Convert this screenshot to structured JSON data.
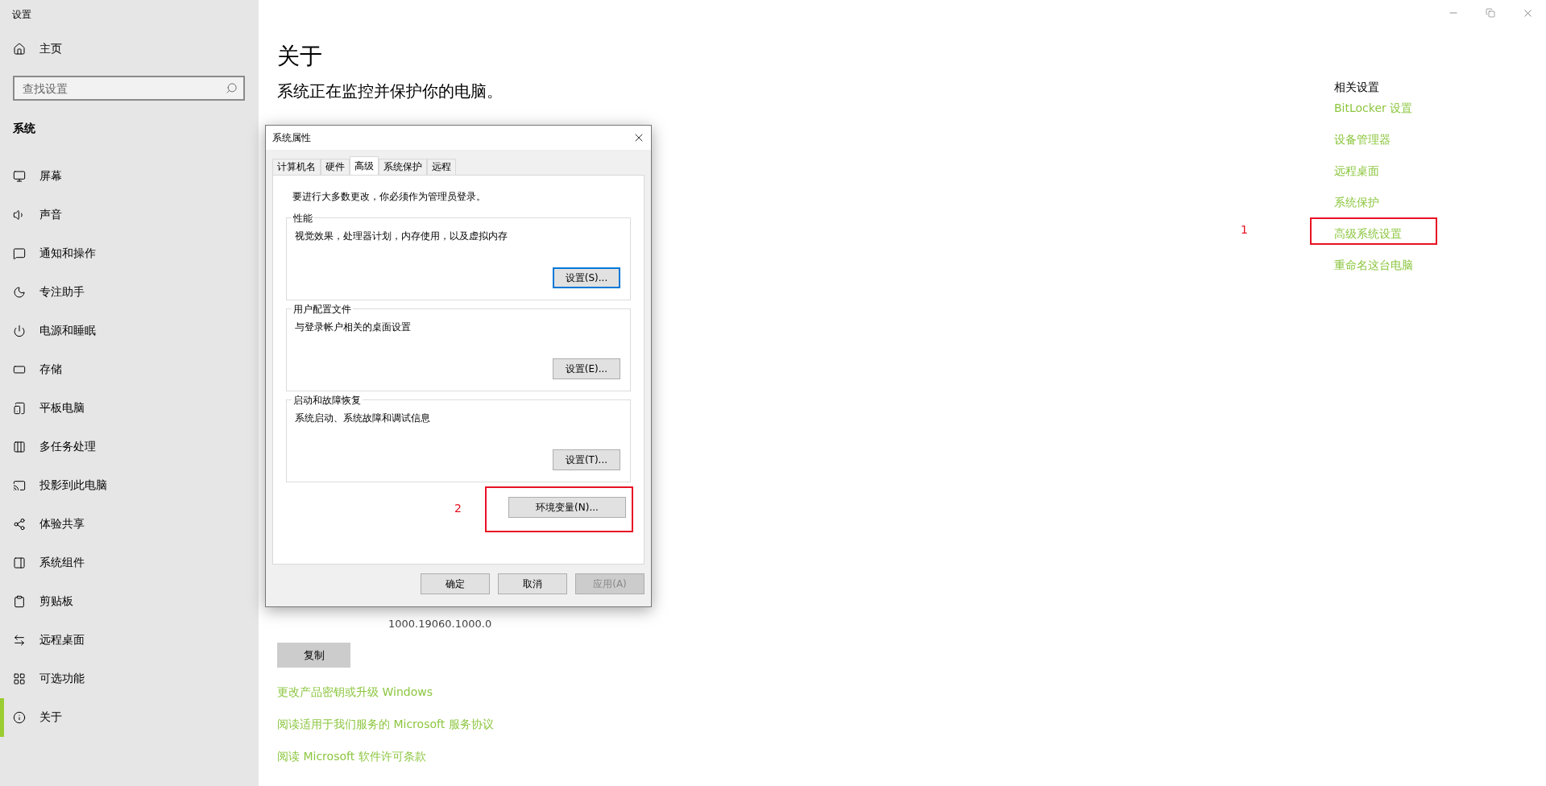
{
  "window": {
    "title": "设置"
  },
  "sidebar": {
    "home": "主页",
    "search": {
      "placeholder": "查找设置"
    },
    "section": "系统",
    "items": [
      {
        "label": "屏幕",
        "selected": false
      },
      {
        "label": "声音",
        "selected": false
      },
      {
        "label": "通知和操作",
        "selected": false
      },
      {
        "label": "专注助手",
        "selected": false
      },
      {
        "label": "电源和睡眠",
        "selected": false
      },
      {
        "label": "存储",
        "selected": false
      },
      {
        "label": "平板电脑",
        "selected": false
      },
      {
        "label": "多任务处理",
        "selected": false
      },
      {
        "label": "投影到此电脑",
        "selected": false
      },
      {
        "label": "体验共享",
        "selected": false
      },
      {
        "label": "系统组件",
        "selected": false
      },
      {
        "label": "剪贴板",
        "selected": false
      },
      {
        "label": "远程桌面",
        "selected": false
      },
      {
        "label": "可选功能",
        "selected": false
      },
      {
        "label": "关于",
        "selected": true
      }
    ]
  },
  "main": {
    "title": "关于",
    "subtitle": "系统正在监控并保护你的电脑。",
    "version": "1000.19060.1000.0",
    "copy_button": "复制",
    "links": [
      "更改产品密钥或升级 Windows",
      "阅读适用于我们服务的 Microsoft 服务协议",
      "阅读 Microsoft 软件许可条款"
    ]
  },
  "related": {
    "title": "相关设置",
    "links": [
      {
        "label": "BitLocker 设置",
        "annotated": false
      },
      {
        "label": "设备管理器",
        "annotated": false
      },
      {
        "label": "远程桌面",
        "annotated": false
      },
      {
        "label": "系统保护",
        "annotated": false
      },
      {
        "label": "高级系统设置",
        "annotated": true,
        "annotation": "1"
      },
      {
        "label": "重命名这台电脑",
        "annotated": false
      }
    ]
  },
  "dialog": {
    "title": "系统属性",
    "tabs": [
      {
        "label": "计算机名",
        "selected": false
      },
      {
        "label": "硬件",
        "selected": false
      },
      {
        "label": "高级",
        "selected": true
      },
      {
        "label": "系统保护",
        "selected": false
      },
      {
        "label": "远程",
        "selected": false
      }
    ],
    "note": "要进行大多数更改，你必须作为管理员登录。",
    "groups": [
      {
        "title": "性能",
        "text": "视觉效果，处理器计划，内存使用，以及虚拟内存",
        "button": "设置(S)...",
        "focused": true
      },
      {
        "title": "用户配置文件",
        "text": "与登录帐户相关的桌面设置",
        "button": "设置(E)...",
        "focused": false
      },
      {
        "title": "启动和故障恢复",
        "text": "系统启动、系统故障和调试信息",
        "button": "设置(T)...",
        "focused": false
      }
    ],
    "env_button": "环境变量(N)...",
    "annotation": "2",
    "buttons": [
      {
        "label": "确定",
        "disabled": false
      },
      {
        "label": "取消",
        "disabled": false
      },
      {
        "label": "应用(A)",
        "disabled": true
      }
    ]
  }
}
